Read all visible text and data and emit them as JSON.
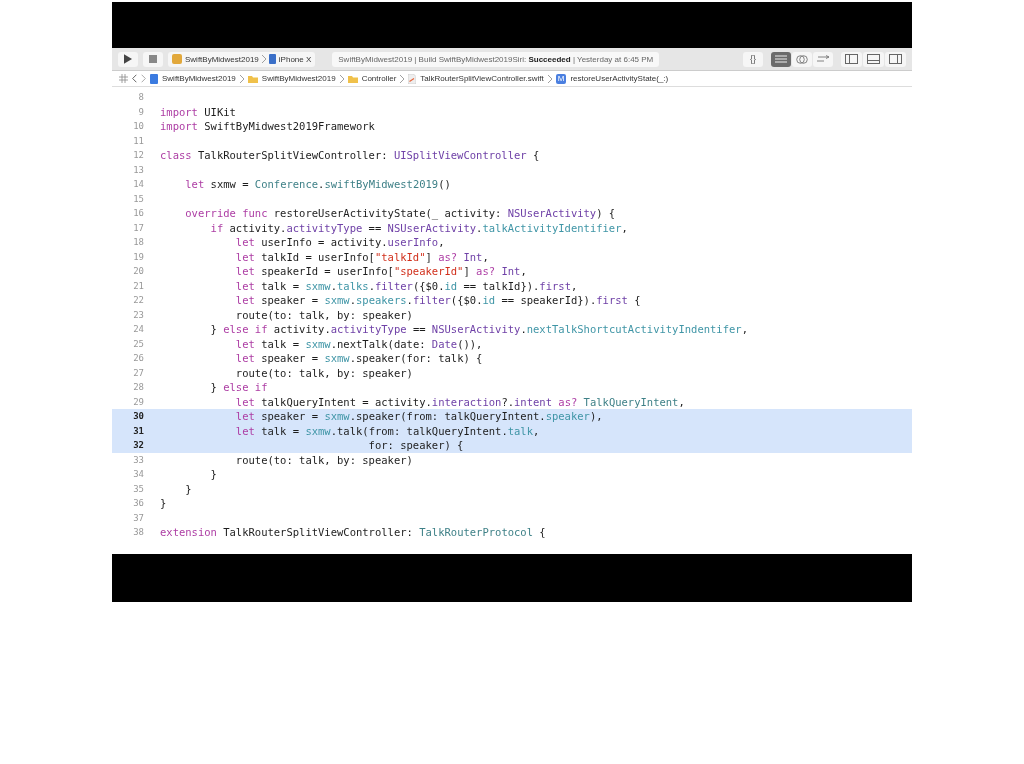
{
  "toolbar": {
    "scheme": "SwiftByMidwest2019",
    "device": "iPhone X",
    "status": "SwiftByMidwest2019 | Build SwiftByMidwest2019Siri: **Succeeded** | Yesterday at 6:45 PM",
    "braces": "{}",
    "editors": [
      {
        "kind": "standard",
        "selected": true
      },
      {
        "kind": "assistant",
        "selected": false
      },
      {
        "kind": "version",
        "selected": false
      }
    ],
    "panels": [
      {
        "kind": "navigator",
        "on": false
      },
      {
        "kind": "debug",
        "on": false
      },
      {
        "kind": "inspector",
        "on": false
      }
    ]
  },
  "breadcrumb": [
    {
      "kind": "project",
      "label": "SwiftByMidwest2019"
    },
    {
      "kind": "folder",
      "label": "SwiftByMidwest2019"
    },
    {
      "kind": "folder",
      "label": "Controller"
    },
    {
      "kind": "swift",
      "label": "TalkRouterSplitViewController.swift"
    },
    {
      "kind": "method",
      "label": "restoreUserActivityState(_:)",
      "badge": "M"
    }
  ],
  "code": [
    {
      "n": "8",
      "selected": false
    },
    {
      "n": "9",
      "selected": false,
      "tokens": [
        {
          "kind": "kw",
          "t": "import"
        },
        {
          "kind": "pl",
          "t": " UIKit"
        }
      ]
    },
    {
      "n": "10",
      "selected": false,
      "tokens": [
        {
          "kind": "kw",
          "t": "import"
        },
        {
          "kind": "pl",
          "t": " SwiftByMidwest2019Framework"
        }
      ]
    },
    {
      "n": "11",
      "selected": false
    },
    {
      "n": "12",
      "selected": false,
      "tokens": [
        {
          "kind": "kw",
          "t": "class"
        },
        {
          "kind": "pl",
          "t": " TalkRouterSplitViewController: "
        },
        {
          "kind": "sys",
          "t": "UISplitViewController"
        },
        {
          "kind": "pl",
          "t": " {"
        }
      ]
    },
    {
      "n": "13",
      "selected": false
    },
    {
      "n": "14",
      "selected": false,
      "tokens": [
        {
          "kind": "kw",
          "t": "    let"
        },
        {
          "kind": "pl",
          "t": " sxmw = "
        },
        {
          "kind": "proj",
          "t": "Conference"
        },
        {
          "kind": "pl",
          "t": "."
        },
        {
          "kind": "proj",
          "t": "swiftByMidwest2019"
        },
        {
          "kind": "pl",
          "t": "()"
        }
      ]
    },
    {
      "n": "15",
      "selected": false
    },
    {
      "n": "16",
      "selected": false,
      "tokens": [
        {
          "kind": "kw",
          "t": "    override func"
        },
        {
          "kind": "pl",
          "t": " restoreUserActivityState(_ activity: "
        },
        {
          "kind": "sys",
          "t": "NSUserActivity"
        },
        {
          "kind": "pl",
          "t": ") {"
        }
      ]
    },
    {
      "n": "17",
      "selected": false,
      "tokens": [
        {
          "kind": "kw",
          "t": "        if"
        },
        {
          "kind": "pl",
          "t": " activity."
        },
        {
          "kind": "sys",
          "t": "activityType"
        },
        {
          "kind": "pl",
          "t": " == "
        },
        {
          "kind": "sys",
          "t": "NSUserActivity"
        },
        {
          "kind": "pl",
          "t": "."
        },
        {
          "kind": "mem",
          "t": "talkActivityIdentifier"
        },
        {
          "kind": "pl",
          "t": ","
        }
      ]
    },
    {
      "n": "18",
      "selected": false,
      "tokens": [
        {
          "kind": "kw",
          "t": "            let"
        },
        {
          "kind": "pl",
          "t": " userInfo = activity."
        },
        {
          "kind": "sys",
          "t": "userInfo"
        },
        {
          "kind": "pl",
          "t": ","
        }
      ]
    },
    {
      "n": "19",
      "selected": false,
      "tokens": [
        {
          "kind": "kw",
          "t": "            let"
        },
        {
          "kind": "pl",
          "t": " talkId = userInfo["
        },
        {
          "kind": "str",
          "t": "\"talkId\""
        },
        {
          "kind": "pl",
          "t": "] "
        },
        {
          "kind": "kw",
          "t": "as?"
        },
        {
          "kind": "sys",
          "t": " Int"
        },
        {
          "kind": "pl",
          "t": ","
        }
      ]
    },
    {
      "n": "20",
      "selected": false,
      "tokens": [
        {
          "kind": "kw",
          "t": "            let"
        },
        {
          "kind": "pl",
          "t": " speakerId = userInfo["
        },
        {
          "kind": "str",
          "t": "\"speakerId\""
        },
        {
          "kind": "pl",
          "t": "] "
        },
        {
          "kind": "kw",
          "t": "as?"
        },
        {
          "kind": "sys",
          "t": " Int"
        },
        {
          "kind": "pl",
          "t": ","
        }
      ]
    },
    {
      "n": "21",
      "selected": false,
      "tokens": [
        {
          "kind": "kw",
          "t": "            let"
        },
        {
          "kind": "pl",
          "t": " talk = "
        },
        {
          "kind": "mem",
          "t": "sxmw"
        },
        {
          "kind": "pl",
          "t": "."
        },
        {
          "kind": "mem",
          "t": "talks"
        },
        {
          "kind": "pl",
          "t": "."
        },
        {
          "kind": "sys",
          "t": "filter"
        },
        {
          "kind": "pl",
          "t": "({$0."
        },
        {
          "kind": "mem",
          "t": "id"
        },
        {
          "kind": "pl",
          "t": " == talkId})."
        },
        {
          "kind": "sys",
          "t": "first"
        },
        {
          "kind": "pl",
          "t": ","
        }
      ]
    },
    {
      "n": "22",
      "selected": false,
      "tokens": [
        {
          "kind": "kw",
          "t": "            let"
        },
        {
          "kind": "pl",
          "t": " speaker = "
        },
        {
          "kind": "mem",
          "t": "sxmw"
        },
        {
          "kind": "pl",
          "t": "."
        },
        {
          "kind": "mem",
          "t": "speakers"
        },
        {
          "kind": "pl",
          "t": "."
        },
        {
          "kind": "sys",
          "t": "filter"
        },
        {
          "kind": "pl",
          "t": "({$0."
        },
        {
          "kind": "mem",
          "t": "id"
        },
        {
          "kind": "pl",
          "t": " == speakerId})."
        },
        {
          "kind": "sys",
          "t": "first"
        },
        {
          "kind": "pl",
          "t": " {"
        }
      ]
    },
    {
      "n": "23",
      "selected": false,
      "tokens": [
        {
          "kind": "pl",
          "t": "            route(to: talk, by: speaker)"
        }
      ]
    },
    {
      "n": "24",
      "selected": false,
      "tokens": [
        {
          "kind": "pl",
          "t": "        } "
        },
        {
          "kind": "kw",
          "t": "else if"
        },
        {
          "kind": "pl",
          "t": " activity."
        },
        {
          "kind": "sys",
          "t": "activityType"
        },
        {
          "kind": "pl",
          "t": " == "
        },
        {
          "kind": "sys",
          "t": "NSUserActivity"
        },
        {
          "kind": "pl",
          "t": "."
        },
        {
          "kind": "mem",
          "t": "nextTalkShortcutActivityIndentifer"
        },
        {
          "kind": "pl",
          "t": ","
        }
      ]
    },
    {
      "n": "25",
      "selected": false,
      "tokens": [
        {
          "kind": "kw",
          "t": "            let"
        },
        {
          "kind": "pl",
          "t": " talk = "
        },
        {
          "kind": "mem",
          "t": "sxmw"
        },
        {
          "kind": "pl",
          "t": ".nextTalk(date: "
        },
        {
          "kind": "sys",
          "t": "Date"
        },
        {
          "kind": "pl",
          "t": "()),"
        }
      ]
    },
    {
      "n": "26",
      "selected": false,
      "tokens": [
        {
          "kind": "kw",
          "t": "            let"
        },
        {
          "kind": "pl",
          "t": " speaker = "
        },
        {
          "kind": "mem",
          "t": "sxmw"
        },
        {
          "kind": "pl",
          "t": ".speaker(for: talk) {"
        }
      ]
    },
    {
      "n": "27",
      "selected": false,
      "tokens": [
        {
          "kind": "pl",
          "t": "            route(to: talk, by: speaker)"
        }
      ]
    },
    {
      "n": "28",
      "selected": false,
      "tokens": [
        {
          "kind": "pl",
          "t": "        } "
        },
        {
          "kind": "kw",
          "t": "else if"
        }
      ]
    },
    {
      "n": "29",
      "selected": false,
      "tokens": [
        {
          "kind": "kw",
          "t": "            let"
        },
        {
          "kind": "pl",
          "t": " talkQueryIntent = activity."
        },
        {
          "kind": "sys",
          "t": "interaction"
        },
        {
          "kind": "pl",
          "t": "?."
        },
        {
          "kind": "sys",
          "t": "intent"
        },
        {
          "kind": "kw",
          "t": " as?"
        },
        {
          "kind": "proj",
          "t": " TalkQueryIntent"
        },
        {
          "kind": "pl",
          "t": ","
        }
      ]
    },
    {
      "n": "30",
      "selected": true,
      "tokens": [
        {
          "kind": "kw",
          "t": "            let"
        },
        {
          "kind": "pl",
          "t": " speaker = "
        },
        {
          "kind": "mem",
          "t": "sxmw"
        },
        {
          "kind": "pl",
          "t": ".speaker(from: talkQueryIntent."
        },
        {
          "kind": "mem",
          "t": "speaker"
        },
        {
          "kind": "pl",
          "t": "),"
        }
      ]
    },
    {
      "n": "31",
      "selected": true,
      "tokens": [
        {
          "kind": "kw",
          "t": "            let"
        },
        {
          "kind": "pl",
          "t": " talk = "
        },
        {
          "kind": "mem",
          "t": "sxmw"
        },
        {
          "kind": "pl",
          "t": ".talk(from: talkQueryIntent."
        },
        {
          "kind": "mem",
          "t": "talk"
        },
        {
          "kind": "pl",
          "t": ","
        }
      ]
    },
    {
      "n": "32",
      "selected": true,
      "tokens": [
        {
          "kind": "pl",
          "t": "                                 for: speaker) {"
        }
      ]
    },
    {
      "n": "33",
      "selected": false,
      "tokens": [
        {
          "kind": "pl",
          "t": "            route(to: talk, by: speaker)"
        }
      ]
    },
    {
      "n": "34",
      "selected": false,
      "tokens": [
        {
          "kind": "pl",
          "t": "        }"
        }
      ]
    },
    {
      "n": "35",
      "selected": false,
      "tokens": [
        {
          "kind": "pl",
          "t": "    }"
        }
      ]
    },
    {
      "n": "36",
      "selected": false,
      "tokens": [
        {
          "kind": "pl",
          "t": "}"
        }
      ]
    },
    {
      "n": "37",
      "selected": false
    },
    {
      "n": "38",
      "selected": false,
      "tokens": [
        {
          "kind": "kw",
          "t": "extension"
        },
        {
          "kind": "pl",
          "t": " TalkRouterSplitViewController: "
        },
        {
          "kind": "proj",
          "t": "TalkRouterProtocol"
        },
        {
          "kind": "pl",
          "t": " {"
        }
      ]
    }
  ]
}
